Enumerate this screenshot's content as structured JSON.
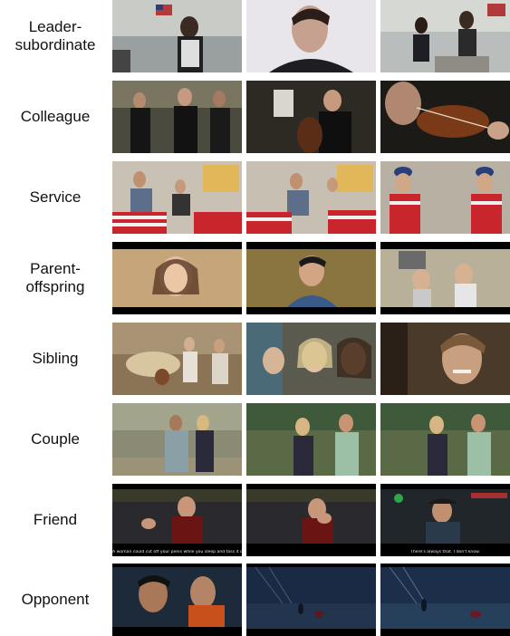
{
  "rows": [
    {
      "label": "Leader-\nsubordinate",
      "subs": [
        "",
        "",
        ""
      ]
    },
    {
      "label": "Colleague",
      "subs": [
        "",
        "",
        ""
      ]
    },
    {
      "label": "Service",
      "subs": [
        "",
        "",
        ""
      ]
    },
    {
      "label": "Parent-\noffspring",
      "subs": [
        "",
        "",
        ""
      ]
    },
    {
      "label": "Sibling",
      "subs": [
        "",
        "",
        ""
      ]
    },
    {
      "label": "Couple",
      "subs": [
        "",
        "",
        ""
      ]
    },
    {
      "label": "Friend",
      "subs": [
        "A woman could cut off your penis while you sleep and toss it out of a car.",
        "",
        "There's always that. I don't know."
      ]
    },
    {
      "label": "Opponent",
      "subs": [
        "",
        "",
        ""
      ]
    }
  ],
  "colors": {
    "background": "#ffffff",
    "label_text": "#111111",
    "subtitle_text": "#e8e8e8"
  }
}
